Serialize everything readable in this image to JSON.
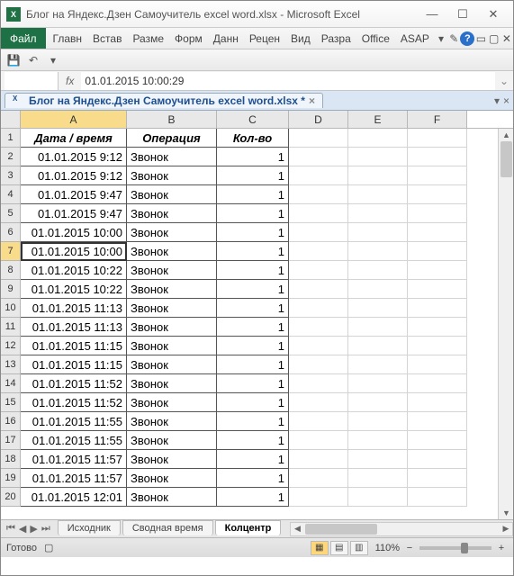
{
  "window": {
    "title": "Блог на Яндекс.Дзен Самоучитель excel word.xlsx  -  Microsoft Excel",
    "min": "—",
    "max": "☐",
    "close": "✕"
  },
  "ribbon": {
    "file": "Файл",
    "tabs": [
      "Главн",
      "Встав",
      "Разме",
      "Форм",
      "Данн",
      "Рецен",
      "Вид",
      "Разра",
      "Office",
      "ASAP"
    ]
  },
  "formula_bar": {
    "fx": "fx",
    "content": "01.01.2015 10:00:29"
  },
  "doc_tab": {
    "label": "Блог на Яндекс.Дзен Самоучитель excel word.xlsx *",
    "close": "×"
  },
  "columns": [
    "A",
    "B",
    "C",
    "D",
    "E",
    "F"
  ],
  "headers": {
    "A": "Дата / время",
    "B": "Операция",
    "C": "Кол-во"
  },
  "active_cell": "A7",
  "data_rows": [
    {
      "n": 2,
      "A": "01.01.2015 9:12",
      "B": "Звонок",
      "C": "1"
    },
    {
      "n": 3,
      "A": "01.01.2015 9:12",
      "B": "Звонок",
      "C": "1"
    },
    {
      "n": 4,
      "A": "01.01.2015 9:47",
      "B": "Звонок",
      "C": "1"
    },
    {
      "n": 5,
      "A": "01.01.2015 9:47",
      "B": "Звонок",
      "C": "1"
    },
    {
      "n": 6,
      "A": "01.01.2015 10:00",
      "B": "Звонок",
      "C": "1"
    },
    {
      "n": 7,
      "A": "01.01.2015 10:00",
      "B": "Звонок",
      "C": "1"
    },
    {
      "n": 8,
      "A": "01.01.2015 10:22",
      "B": "Звонок",
      "C": "1"
    },
    {
      "n": 9,
      "A": "01.01.2015 10:22",
      "B": "Звонок",
      "C": "1"
    },
    {
      "n": 10,
      "A": "01.01.2015 11:13",
      "B": "Звонок",
      "C": "1"
    },
    {
      "n": 11,
      "A": "01.01.2015 11:13",
      "B": "Звонок",
      "C": "1"
    },
    {
      "n": 12,
      "A": "01.01.2015 11:15",
      "B": "Звонок",
      "C": "1"
    },
    {
      "n": 13,
      "A": "01.01.2015 11:15",
      "B": "Звонок",
      "C": "1"
    },
    {
      "n": 14,
      "A": "01.01.2015 11:52",
      "B": "Звонок",
      "C": "1"
    },
    {
      "n": 15,
      "A": "01.01.2015 11:52",
      "B": "Звонок",
      "C": "1"
    },
    {
      "n": 16,
      "A": "01.01.2015 11:55",
      "B": "Звонок",
      "C": "1"
    },
    {
      "n": 17,
      "A": "01.01.2015 11:55",
      "B": "Звонок",
      "C": "1"
    },
    {
      "n": 18,
      "A": "01.01.2015 11:57",
      "B": "Звонок",
      "C": "1"
    },
    {
      "n": 19,
      "A": "01.01.2015 11:57",
      "B": "Звонок",
      "C": "1"
    },
    {
      "n": 20,
      "A": "01.01.2015 12:01",
      "B": "Звонок",
      "C": "1"
    }
  ],
  "sheet_tabs": {
    "items": [
      "Исходник",
      "Сводная время",
      "Колцентр"
    ],
    "active": 2
  },
  "statusbar": {
    "ready": "Готово",
    "zoom": "110%",
    "minus": "−",
    "plus": "+"
  }
}
